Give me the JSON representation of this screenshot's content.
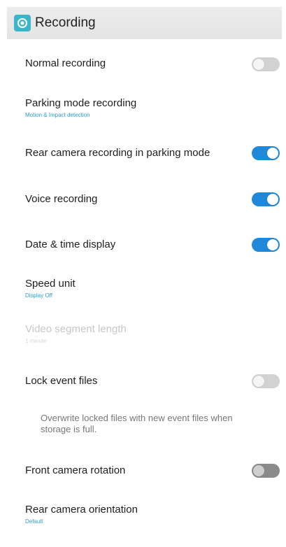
{
  "header": {
    "icon": "recording-app-icon",
    "title": "Recording"
  },
  "settings": [
    {
      "label": "Normal recording",
      "state": "off"
    },
    {
      "label": "Parking mode recording",
      "subtitle": "Motion & Impact detection"
    },
    {
      "label": "Rear camera recording in parking mode",
      "state": "on"
    },
    {
      "label": "Voice recording",
      "state": "on"
    },
    {
      "label": "Date & time display",
      "state": "on"
    },
    {
      "label": "Speed unit",
      "subtitle": "Display Off"
    },
    {
      "label": "Video segment length",
      "subtitle": "1 minute",
      "disabled": true
    },
    {
      "label": "Lock event files",
      "state": "off"
    },
    {
      "label": "Front camera rotation",
      "state": "off"
    },
    {
      "label": "Rear camera orientation",
      "subtitle": "Default"
    }
  ],
  "note": "Overwrite locked files with new event files when storage is full.",
  "colors": {
    "accent": "#1f88d9",
    "subtitle": "#2f9ccc",
    "toggle_off": "#d2d2d2"
  }
}
